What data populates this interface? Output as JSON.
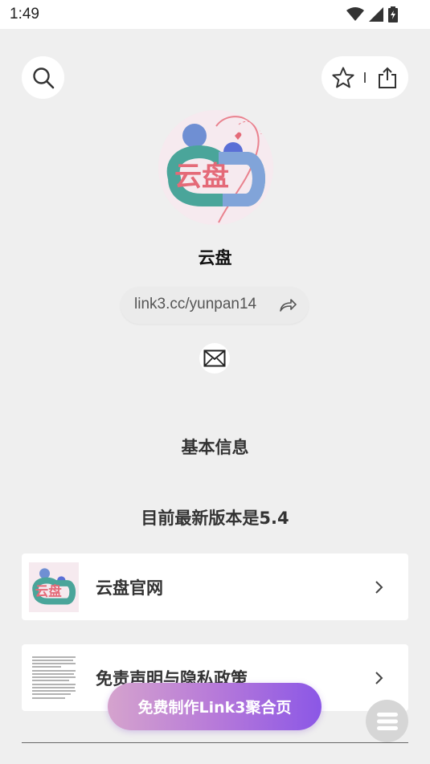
{
  "status_bar": {
    "time": "1:49"
  },
  "profile": {
    "name": "云盘",
    "link": "link3.cc/yunpan14",
    "avatar_text": "云盘"
  },
  "sections": {
    "basic_info": "基本信息",
    "latest_version": "目前最新版本是5.4"
  },
  "links": [
    {
      "label": "云盘官网",
      "thumb_text": "云盘"
    },
    {
      "label": "免责声明与隐私政策"
    }
  ],
  "cta": {
    "label": "免费制作Link3聚合页"
  },
  "colors": {
    "background": "#efefef",
    "cta_start": "#d5a3cd",
    "cta_end": "#8b57e6",
    "logo_red": "#e46a78",
    "logo_teal": "#4aa59a",
    "logo_blue": "#5a6fd6"
  },
  "icons": [
    "search-icon",
    "star-icon",
    "share-icon",
    "forward-arrow-icon",
    "mail-icon",
    "chevron-right-icon",
    "menu-icon",
    "wifi-icon",
    "signal-icon",
    "battery-icon"
  ]
}
